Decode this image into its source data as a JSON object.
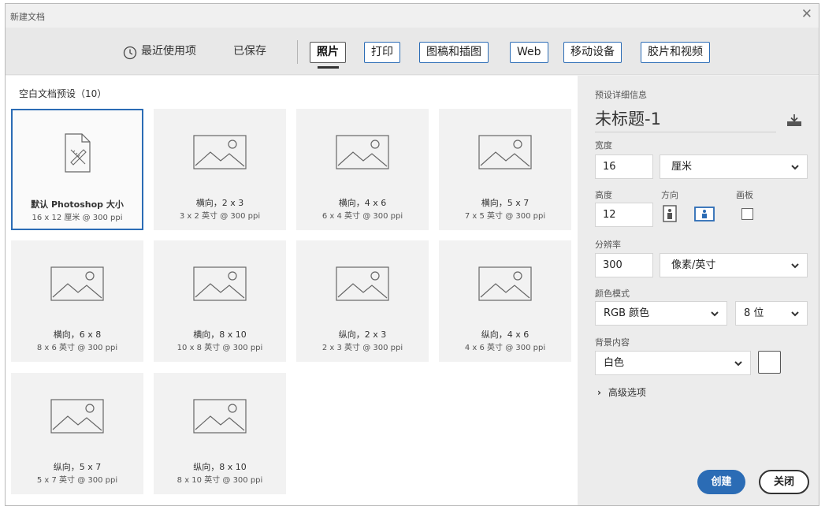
{
  "window": {
    "title": "新建文档",
    "close_icon": "close-icon"
  },
  "tabs": {
    "recent": "最近使用项",
    "saved": "已保存",
    "photo": "照片",
    "print": "打印",
    "art": "图稿和插图",
    "web": "Web",
    "mobile": "移动设备",
    "film": "胶片和视频",
    "active": "照片"
  },
  "presets": {
    "heading": "空白文档预设（10）",
    "items": [
      {
        "title": "默认 Photoshop 大小",
        "subtitle": "16 x 12 厘米 @ 300 ppi",
        "icon": "document-tools-icon",
        "selected": true
      },
      {
        "title": "横向，2 x 3",
        "subtitle": "3 x 2 英寸 @ 300 ppi",
        "icon": "image-placeholder-icon"
      },
      {
        "title": "横向，4 x 6",
        "subtitle": "6 x 4 英寸 @ 300 ppi",
        "icon": "image-placeholder-icon"
      },
      {
        "title": "横向，5 x 7",
        "subtitle": "7 x 5 英寸 @ 300 ppi",
        "icon": "image-placeholder-icon"
      },
      {
        "title": "横向，6 x 8",
        "subtitle": "8 x 6 英寸 @ 300 ppi",
        "icon": "image-placeholder-icon"
      },
      {
        "title": "横向，8 x 10",
        "subtitle": "10 x 8 英寸 @ 300 ppi",
        "icon": "image-placeholder-icon"
      },
      {
        "title": "纵向，2 x 3",
        "subtitle": "2 x 3 英寸 @ 300 ppi",
        "icon": "image-placeholder-icon"
      },
      {
        "title": "纵向，4 x 6",
        "subtitle": "4 x 6 英寸 @ 300 ppi",
        "icon": "image-placeholder-icon"
      },
      {
        "title": "纵向，5 x 7",
        "subtitle": "5 x 7 英寸 @ 300 ppi",
        "icon": "image-placeholder-icon"
      },
      {
        "title": "纵向，8 x 10",
        "subtitle": "8 x 10 英寸 @ 300 ppi",
        "icon": "image-placeholder-icon"
      }
    ]
  },
  "details": {
    "heading": "预设详细信息",
    "doc_name": "未标题-1",
    "width_label": "宽度",
    "width_value": "16",
    "width_unit": "厘米",
    "height_label": "高度",
    "height_value": "12",
    "orientation_label": "方向",
    "artboard_label": "画板",
    "resolution_label": "分辨率",
    "resolution_value": "300",
    "resolution_unit": "像素/英寸",
    "color_mode_label": "颜色模式",
    "color_mode_value": "RGB 颜色",
    "bit_depth_value": "8 位",
    "background_label": "背景内容",
    "background_value": "白色",
    "background_swatch": "#ffffff",
    "advanced_label": "高级选项"
  },
  "buttons": {
    "create": "创建",
    "close": "关闭"
  },
  "colors": {
    "accent": "#2b6cb5",
    "panel": "#ececec",
    "card": "#f2f2f2"
  }
}
